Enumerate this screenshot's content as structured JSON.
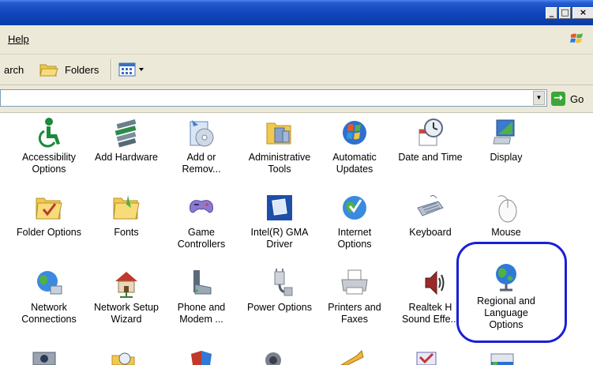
{
  "window": {
    "minimize_glyph": "_",
    "maximize_glyph": "□",
    "close_glyph": "×"
  },
  "menubar": {
    "help_label": "Help"
  },
  "toolbar": {
    "search_partial": "arch",
    "folders_label": "Folders"
  },
  "addressbar": {
    "value": "",
    "go_arrow": "→",
    "go_label": "Go"
  },
  "items": [
    {
      "name": "accessibility-options",
      "label": "Accessibility\nOptions",
      "icon": "accessibility-icon"
    },
    {
      "name": "add-hardware",
      "label": "Add Hardware",
      "icon": "add-hardware-icon"
    },
    {
      "name": "add-or-remove",
      "label": "Add or\nRemov...",
      "icon": "add-remove-programs-icon"
    },
    {
      "name": "administrative-tools",
      "label": "Administrative\nTools",
      "icon": "administrative-tools-icon"
    },
    {
      "name": "automatic-updates",
      "label": "Automatic\nUpdates",
      "icon": "automatic-updates-icon"
    },
    {
      "name": "date-and-time",
      "label": "Date and Time",
      "icon": "date-time-icon"
    },
    {
      "name": "display",
      "label": "Display",
      "icon": "display-icon"
    },
    {
      "name": "folder-options",
      "label": "Folder Options",
      "icon": "folder-options-icon"
    },
    {
      "name": "fonts",
      "label": "Fonts",
      "icon": "fonts-folder-icon"
    },
    {
      "name": "game-controllers",
      "label": "Game\nControllers",
      "icon": "game-controller-icon"
    },
    {
      "name": "intel-gma-driver",
      "label": "Intel(R) GMA\nDriver",
      "icon": "intel-gma-icon"
    },
    {
      "name": "internet-options",
      "label": "Internet\nOptions",
      "icon": "internet-options-icon"
    },
    {
      "name": "keyboard",
      "label": "Keyboard",
      "icon": "keyboard-icon"
    },
    {
      "name": "mouse",
      "label": "Mouse",
      "icon": "mouse-icon"
    },
    {
      "name": "network-connections",
      "label": "Network\nConnections",
      "icon": "network-globe-icon"
    },
    {
      "name": "network-setup-wizard",
      "label": "Network Setup\nWizard",
      "icon": "network-house-icon"
    },
    {
      "name": "phone-and-modem",
      "label": "Phone and\nModem ...",
      "icon": "phone-modem-icon"
    },
    {
      "name": "power-options",
      "label": "Power Options",
      "icon": "power-plug-icon"
    },
    {
      "name": "printers-and-faxes",
      "label": "Printers and\nFaxes",
      "icon": "printer-icon"
    },
    {
      "name": "realtek-sound",
      "label": "Realtek H\nSound Effe...",
      "icon": "speaker-icon"
    },
    {
      "name": "regional-and-language",
      "label": "Regional and\nLanguage\nOptions",
      "icon": "globe-icon"
    }
  ],
  "highlight_color": "#1a1fd6",
  "titlebar_color": "#0a3ba5"
}
